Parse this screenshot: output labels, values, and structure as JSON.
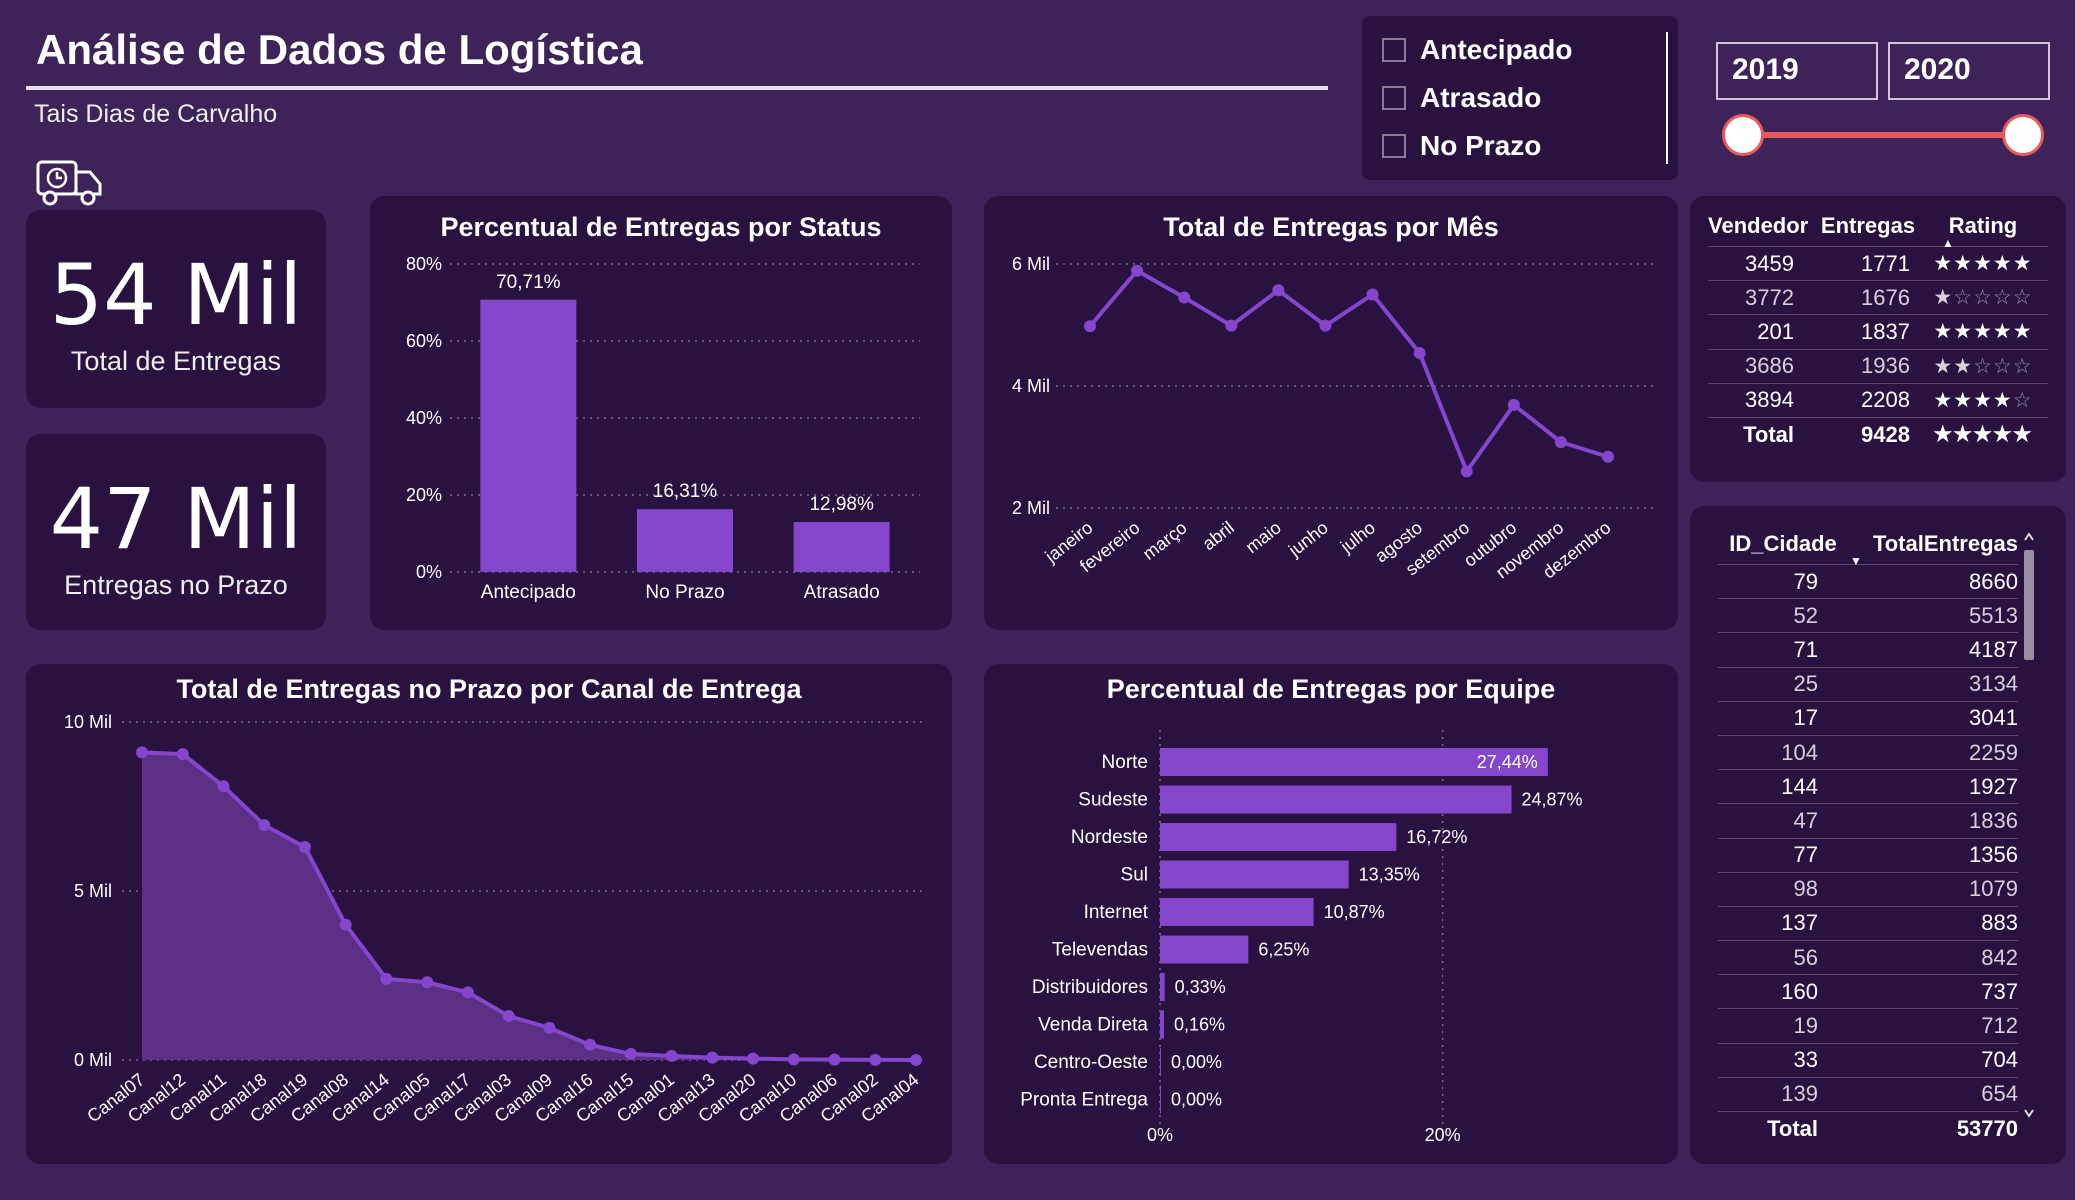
{
  "header": {
    "title": "Análise de Dados de Logística",
    "author": "Tais Dias de Carvalho"
  },
  "icons": {
    "logo": "delivery-truck-clock-icon"
  },
  "kpis": [
    {
      "value": "54 Mil",
      "label": "Total de Entregas"
    },
    {
      "value": "47 Mil",
      "label": "Entregas no Prazo"
    }
  ],
  "status_filter": {
    "options": [
      "Antecipado",
      "Atrasado",
      "No Prazo"
    ]
  },
  "year_slider": {
    "from": "2019",
    "to": "2020",
    "accent": "#e85a5a"
  },
  "colors": {
    "bar": "#8446cc",
    "panel": "#2a1240",
    "background": "#3d2357"
  },
  "chart_data": [
    {
      "id": "status",
      "type": "bar",
      "title": "Percentual de Entregas por Status",
      "categories": [
        "Antecipado",
        "No Prazo",
        "Atrasado"
      ],
      "values": [
        70.71,
        16.31,
        12.98
      ],
      "value_labels": [
        "70,71%",
        "16,31%",
        "12,98%"
      ],
      "yticks": [
        "0%",
        "20%",
        "40%",
        "60%",
        "80%"
      ],
      "ylim": [
        0,
        80
      ]
    },
    {
      "id": "monthly",
      "type": "line",
      "title": "Total de Entregas por Mês",
      "categories": [
        "janeiro",
        "fevereiro",
        "março",
        "abril",
        "maio",
        "junho",
        "julho",
        "agosto",
        "setembro",
        "outubro",
        "novembro",
        "dezembro"
      ],
      "values": [
        4980,
        5890,
        5450,
        4990,
        5570,
        4990,
        5500,
        4540,
        2600,
        3690,
        3080,
        2840
      ],
      "yticks": [
        "2 Mil",
        "4 Mil",
        "6 Mil"
      ],
      "ylim": [
        2000,
        6000
      ]
    },
    {
      "id": "channel",
      "type": "area",
      "title": "Total de Entregas no Prazo por Canal de Entrega",
      "categories": [
        "Canal07",
        "Canal12",
        "Canal11",
        "Canal18",
        "Canal19",
        "Canal08",
        "Canal14",
        "Canal05",
        "Canal17",
        "Canal03",
        "Canal09",
        "Canal16",
        "Canal15",
        "Canal01",
        "Canal13",
        "Canal20",
        "Canal10",
        "Canal06",
        "Canal02",
        "Canal04"
      ],
      "values": [
        9100,
        9050,
        8100,
        6950,
        6300,
        4000,
        2400,
        2300,
        2000,
        1300,
        950,
        450,
        180,
        120,
        70,
        40,
        20,
        10,
        5,
        0
      ],
      "yticks": [
        "0 Mil",
        "5 Mil",
        "10 Mil"
      ],
      "ylim": [
        0,
        10000
      ]
    },
    {
      "id": "team",
      "type": "bar",
      "orientation": "horizontal",
      "title": "Percentual de Entregas por Equipe",
      "categories": [
        "Norte",
        "Sudeste",
        "Nordeste",
        "Sul",
        "Internet",
        "Televendas",
        "Distribuidores",
        "Venda Direta",
        "Centro-Oeste",
        "Pronta Entrega"
      ],
      "values": [
        27.44,
        24.87,
        16.72,
        13.35,
        10.87,
        6.25,
        0.33,
        0.16,
        0.0,
        0.0
      ],
      "value_labels": [
        "27,44%",
        "24,87%",
        "16,72%",
        "13,35%",
        "10,87%",
        "6,25%",
        "0,33%",
        "0,16%",
        "0,00%",
        "0,00%"
      ],
      "xticks": [
        "0%",
        "20%"
      ],
      "xlim": [
        0,
        30
      ]
    }
  ],
  "seller_table": {
    "headers": [
      "Vendedor",
      "Entregas",
      "Rating"
    ],
    "rows": [
      {
        "vendedor": "3459",
        "entregas": "1771",
        "rating": 5
      },
      {
        "vendedor": "3772",
        "entregas": "1676",
        "rating": 1
      },
      {
        "vendedor": "201",
        "entregas": "1837",
        "rating": 5
      },
      {
        "vendedor": "3686",
        "entregas": "1936",
        "rating": 2
      },
      {
        "vendedor": "3894",
        "entregas": "2208",
        "rating": 4
      }
    ],
    "total": {
      "label": "Total",
      "entregas": "9428",
      "rating": 5
    }
  },
  "city_table": {
    "headers": [
      "ID_Cidade",
      "TotalEntregas"
    ],
    "rows": [
      [
        "79",
        "8660"
      ],
      [
        "52",
        "5513"
      ],
      [
        "71",
        "4187"
      ],
      [
        "25",
        "3134"
      ],
      [
        "17",
        "3041"
      ],
      [
        "104",
        "2259"
      ],
      [
        "144",
        "1927"
      ],
      [
        "47",
        "1836"
      ],
      [
        "77",
        "1356"
      ],
      [
        "98",
        "1079"
      ],
      [
        "137",
        "883"
      ],
      [
        "56",
        "842"
      ],
      [
        "160",
        "737"
      ],
      [
        "19",
        "712"
      ],
      [
        "33",
        "704"
      ],
      [
        "139",
        "654"
      ]
    ],
    "total": {
      "label": "Total",
      "value": "53770"
    }
  }
}
